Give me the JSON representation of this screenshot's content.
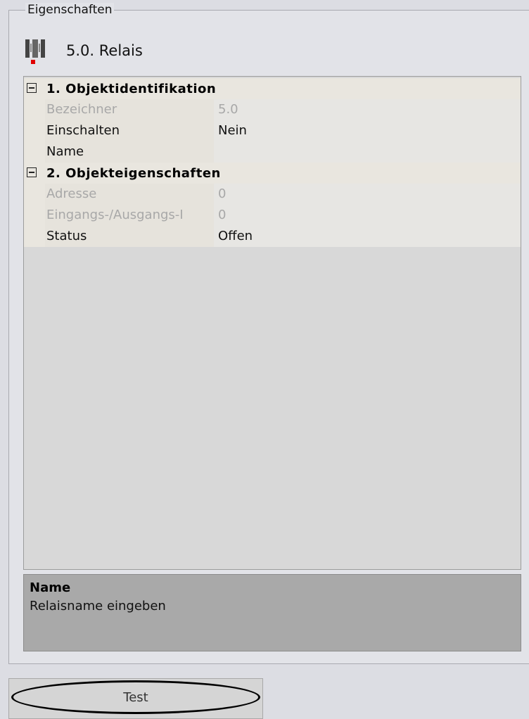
{
  "panel": {
    "title": "Eigenschaften"
  },
  "object": {
    "icon": "relay-icon",
    "title": "5.0. Relais"
  },
  "grid": {
    "categories": [
      {
        "label": "1. Objektidentifikation",
        "rows": [
          {
            "name": "Bezeichner",
            "value": "5.0",
            "readonly": true
          },
          {
            "name": "Einschalten",
            "value": "Nein",
            "readonly": false
          },
          {
            "name": "Name",
            "value": "",
            "readonly": false
          }
        ]
      },
      {
        "label": "2. Objekteigenschaften",
        "rows": [
          {
            "name": "Adresse",
            "value": "0",
            "readonly": true
          },
          {
            "name": "Eingangs-/Ausgangs-I",
            "value": "0",
            "readonly": true
          },
          {
            "name": "Status",
            "value": "Offen",
            "readonly": false
          }
        ]
      }
    ]
  },
  "description": {
    "title": "Name",
    "text": "Relaisname eingeben"
  },
  "test_button": {
    "label": "Test"
  }
}
